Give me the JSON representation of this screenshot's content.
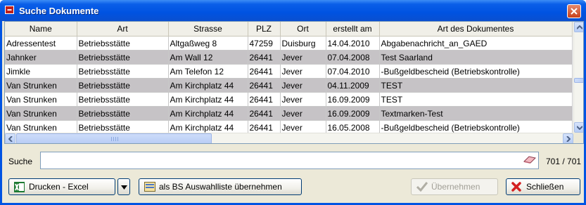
{
  "window": {
    "title": "Suche Dokumente"
  },
  "table": {
    "columns": [
      "Name",
      "Art",
      "Strasse",
      "PLZ",
      "Ort",
      "erstellt am",
      "Art des Dokumentes"
    ],
    "rows": [
      [
        "Adressentest",
        "Betriebsstätte",
        "Altgaßweg 8",
        "47259",
        "Duisburg",
        "14.04.2010",
        "Abgabenachricht_an_GAED"
      ],
      [
        "Jahnker",
        "Betriebsstätte",
        "Am Wall 12",
        "26441",
        "Jever",
        "07.04.2008",
        "Test Saarland"
      ],
      [
        "Jimkle",
        "Betriebsstätte",
        "Am Telefon 12",
        "26441",
        "Jever",
        "07.04.2010",
        "-Bußgeldbescheid (Betriebskontrolle)"
      ],
      [
        "Van Strunken",
        "Betriebsstätte",
        "Am Kirchplatz 44",
        "26441",
        "Jever",
        "04.11.2009",
        "TEST"
      ],
      [
        "Van Strunken",
        "Betriebsstätte",
        "Am Kirchplatz 44",
        "26441",
        "Jever",
        "16.09.2009",
        "TEST"
      ],
      [
        "Van Strunken",
        "Betriebsstätte",
        "Am Kirchplatz 44",
        "26441",
        "Jever",
        "16.09.2009",
        "Textmarken-Test"
      ],
      [
        "Van Strunken",
        "Betriebsstätte",
        "Am Kirchplatz 44",
        "26441",
        "Jever",
        "16.05.2008",
        "-Bußgeldbescheid (Betriebskontrolle)"
      ]
    ]
  },
  "search": {
    "label": "Suche",
    "value": "",
    "count": "701 / 701"
  },
  "buttons": {
    "excel": "Drucken - Excel",
    "bs_list": "als BS Auswahlliste übernehmen",
    "apply": "Übernehmen",
    "close": "Schließen"
  },
  "colors": {
    "title_bar": "#0054e3",
    "row_alt": "#c6c3c6",
    "window_bg": "#ece9d8"
  },
  "icons": {
    "title": "app-icon",
    "close": "close-icon",
    "search_clear": "eraser-icon",
    "excel": "excel-icon",
    "bs_list": "list-icon",
    "apply": "checkmark-icon",
    "close_button": "red-x-icon"
  }
}
